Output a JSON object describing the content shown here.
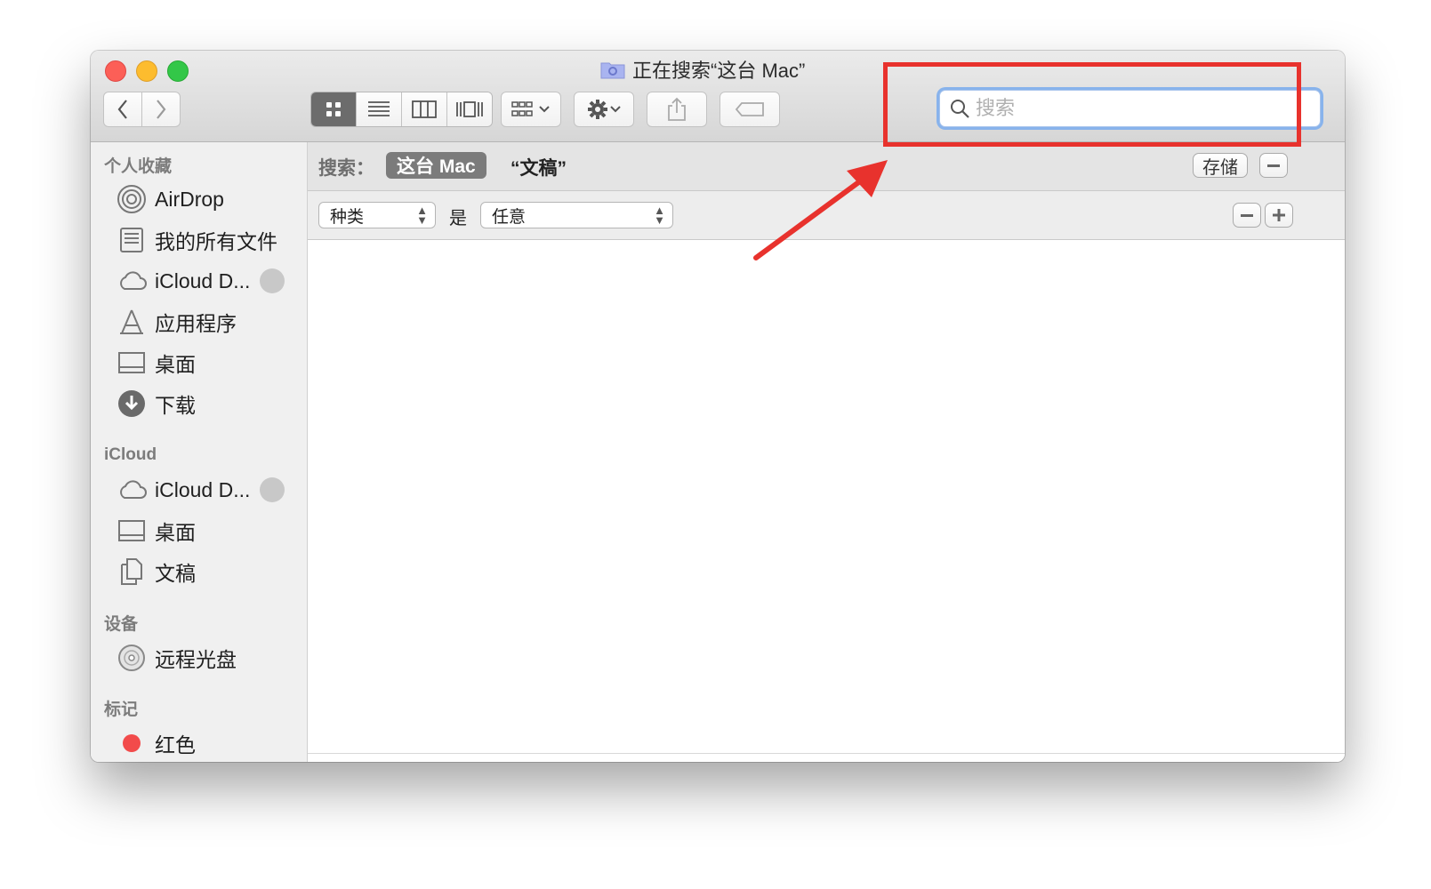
{
  "window": {
    "title": "正在搜索“这台 Mac”"
  },
  "toolbar": {
    "back_icon": "chevron-left-icon",
    "forward_icon": "chevron-right-icon",
    "view_modes": [
      "icon-view",
      "list-view",
      "column-view",
      "cover-flow-view"
    ],
    "active_view": "icon-view",
    "group_icon": "group-icon",
    "action_icon": "gear-icon",
    "share_icon": "share-icon",
    "tag_icon": "tag-icon"
  },
  "search": {
    "placeholder": "搜索",
    "value": ""
  },
  "sidebar": {
    "sections": [
      {
        "heading": "个人收藏",
        "items": [
          {
            "label": "AirDrop",
            "icon": "airdrop-icon"
          },
          {
            "label": "我的所有文件",
            "icon": "all-files-icon"
          },
          {
            "label": "iCloud D...",
            "icon": "cloud-icon"
          },
          {
            "label": "应用程序",
            "icon": "applications-icon"
          },
          {
            "label": "桌面",
            "icon": "desktop-icon"
          },
          {
            "label": "下载",
            "icon": "download-icon"
          }
        ]
      },
      {
        "heading": "iCloud",
        "items": [
          {
            "label": "iCloud D...",
            "icon": "cloud-icon"
          },
          {
            "label": "桌面",
            "icon": "desktop-icon"
          },
          {
            "label": "文稿",
            "icon": "documents-icon"
          }
        ]
      },
      {
        "heading": "设备",
        "items": [
          {
            "label": "远程光盘",
            "icon": "disc-icon"
          }
        ]
      },
      {
        "heading": "标记",
        "items": [
          {
            "label": "红色",
            "icon": "red-tag-icon"
          }
        ]
      }
    ]
  },
  "scope": {
    "label": "搜索：",
    "this_mac": "这台 Mac",
    "folder": "“文稿”",
    "save": "存储"
  },
  "criteria": {
    "attribute": "种类",
    "operator": "是",
    "value": "任意"
  },
  "colors": {
    "annotation": "#e8322d",
    "focus_ring": "#88b3ec",
    "active_segment": "#6c6c6c"
  }
}
